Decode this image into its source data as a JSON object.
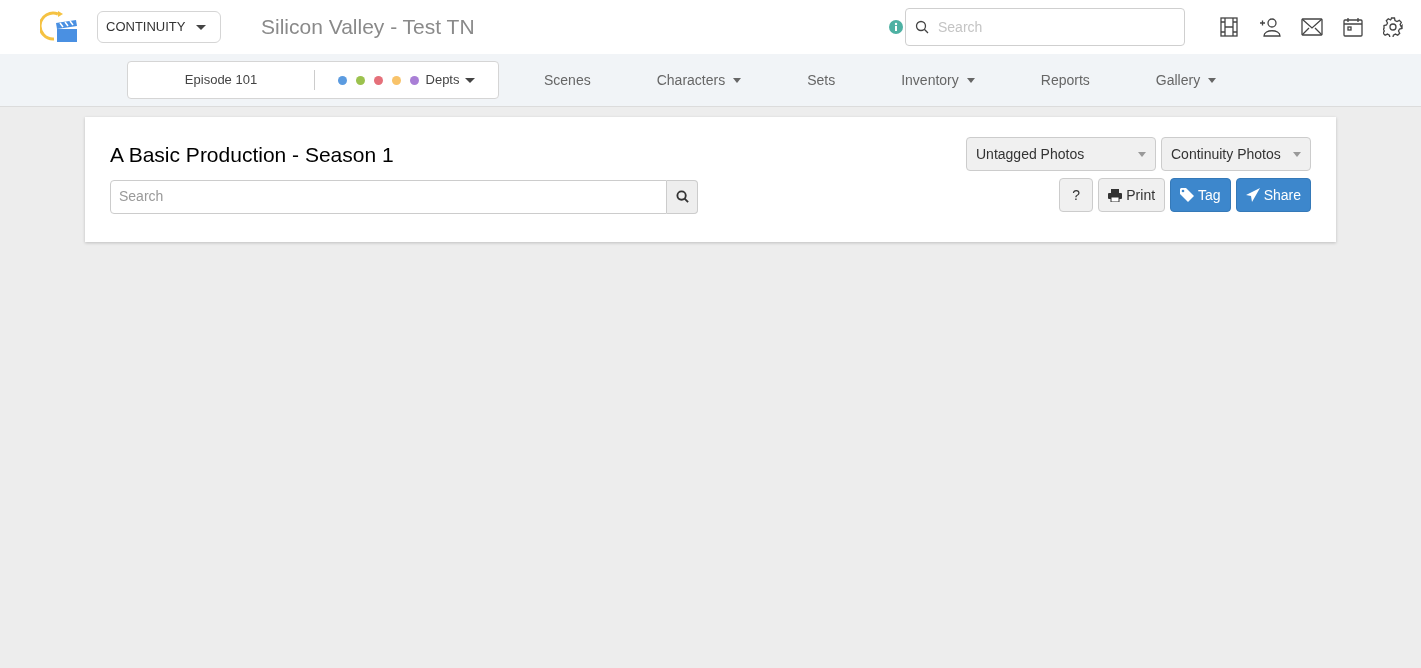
{
  "header": {
    "module_select": "CONTINUITY",
    "project_title": "Silicon Valley - Test TN",
    "search": {
      "placeholder": "Search"
    }
  },
  "nav": {
    "episode": "Episode 101",
    "departments": {
      "label": "Depts",
      "dots": [
        {
          "color": "#5b9be0"
        },
        {
          "color": "#9cc24e"
        },
        {
          "color": "#e5707a"
        },
        {
          "color": "#f8c36a"
        },
        {
          "color": "#a97fd6"
        }
      ]
    },
    "items": [
      {
        "label": "Scenes",
        "has_menu": false
      },
      {
        "label": "Characters",
        "has_menu": true
      },
      {
        "label": "Sets",
        "has_menu": false
      },
      {
        "label": "Inventory",
        "has_menu": true
      },
      {
        "label": "Reports",
        "has_menu": false
      },
      {
        "label": "Gallery",
        "has_menu": true
      }
    ]
  },
  "panel": {
    "title": "A Basic Production - Season 1",
    "search": {
      "placeholder": "Search"
    },
    "filters": [
      "Untagged Photos",
      "Continuity Photos"
    ],
    "buttons": [
      {
        "kind": "help",
        "label": "?"
      },
      {
        "kind": "print",
        "label": "Print"
      },
      {
        "kind": "tag",
        "label": "Tag"
      },
      {
        "kind": "share",
        "label": "Share"
      }
    ]
  }
}
